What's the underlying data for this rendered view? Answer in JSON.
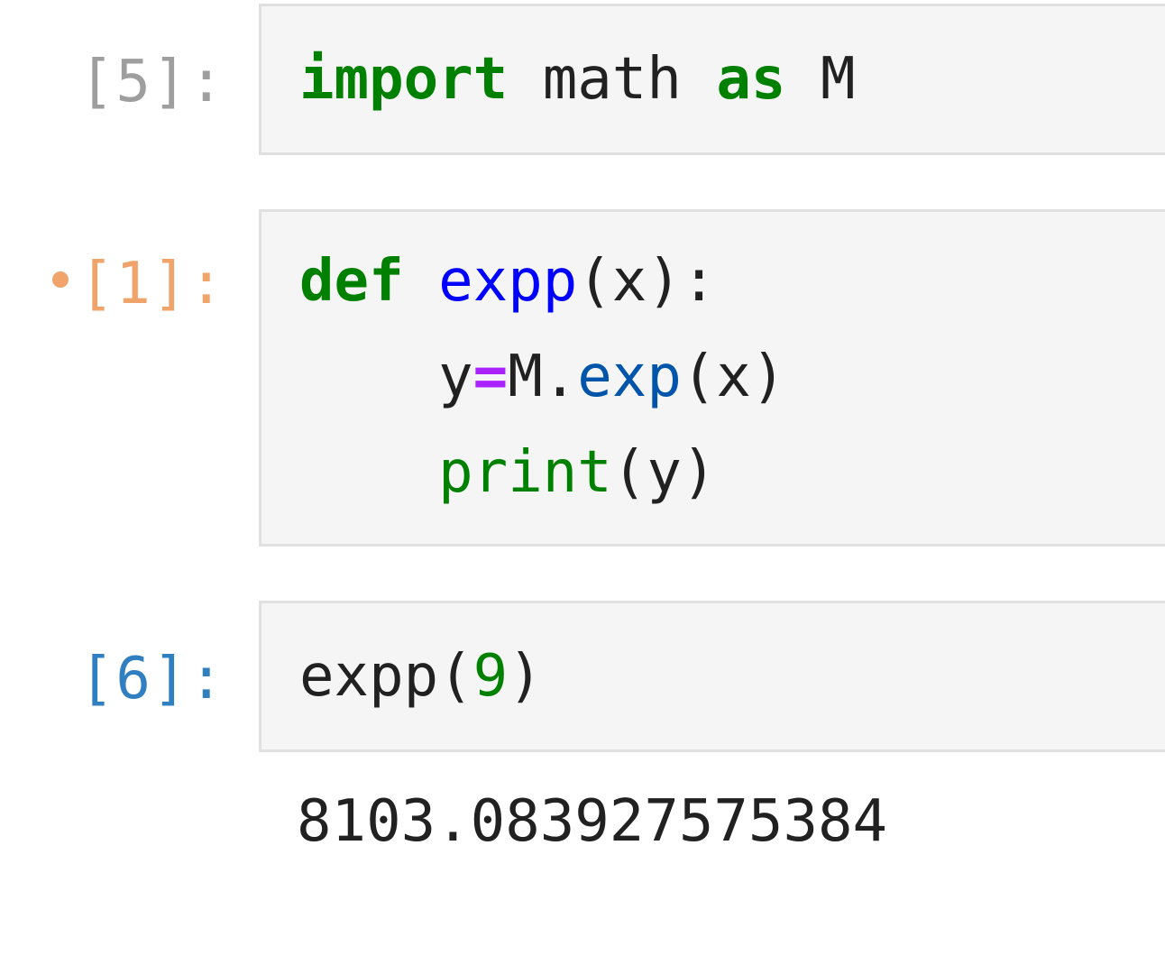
{
  "cells": [
    {
      "prompt": "[5]:",
      "code": {
        "kw_import": "import",
        "module": " math ",
        "kw_as": "as",
        "alias": " M"
      }
    },
    {
      "prompt": "[1]:",
      "modified": true,
      "code": {
        "line1_kw": "def",
        "line1_name": "expp",
        "line1_rest": "(x):",
        "line2_indent": "    ",
        "line2_var": "y",
        "line2_op": "=",
        "line2_mod": "M.",
        "line2_attr": "exp",
        "line2_rest": "(x)",
        "line3_indent": "    ",
        "line3_builtin": "print",
        "line3_rest": "(y)"
      }
    },
    {
      "prompt": "[6]:",
      "code": {
        "call": "expp(",
        "arg": "9",
        "close": ")"
      },
      "output": "8103.083927575384"
    }
  ],
  "colors": {
    "keyword": "#008000",
    "function_def": "#0000ff",
    "operator": "#aa22ff",
    "prompt_executed": "#9e9e9e",
    "prompt_modified": "#f0a36b",
    "prompt_active": "#307fc1",
    "editor_bg": "#f5f5f5"
  }
}
